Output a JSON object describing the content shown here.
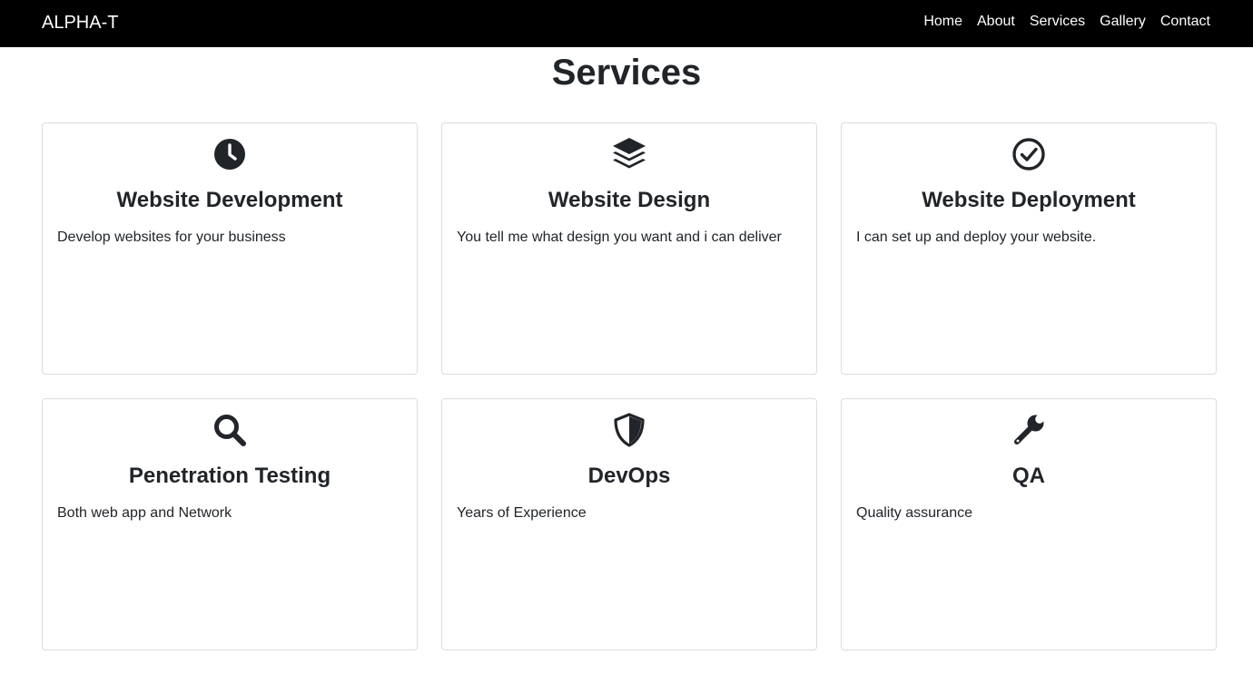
{
  "nav": {
    "brand": "ALPHA-T",
    "links": [
      "Home",
      "About",
      "Services",
      "Gallery",
      "Contact"
    ]
  },
  "page": {
    "title": "Services"
  },
  "services": [
    {
      "icon": "clock-icon",
      "title": "Website Development",
      "text": "Develop websites for your business"
    },
    {
      "icon": "layers-icon",
      "title": "Website Design",
      "text": "You tell me what design you want and i can deliver"
    },
    {
      "icon": "check-circle-icon",
      "title": "Website Deployment",
      "text": "I can set up and deploy your website."
    },
    {
      "icon": "search-icon",
      "title": "Penetration Testing",
      "text": "Both web app and Network"
    },
    {
      "icon": "shield-icon",
      "title": "DevOps",
      "text": "Years of Experience"
    },
    {
      "icon": "wrench-icon",
      "title": "QA",
      "text": "Quality assurance"
    }
  ],
  "colors": {
    "navbar_bg": "#000000",
    "nav_text": "#ffffff",
    "text": "#212529",
    "card_border": "#dcdcdc"
  }
}
